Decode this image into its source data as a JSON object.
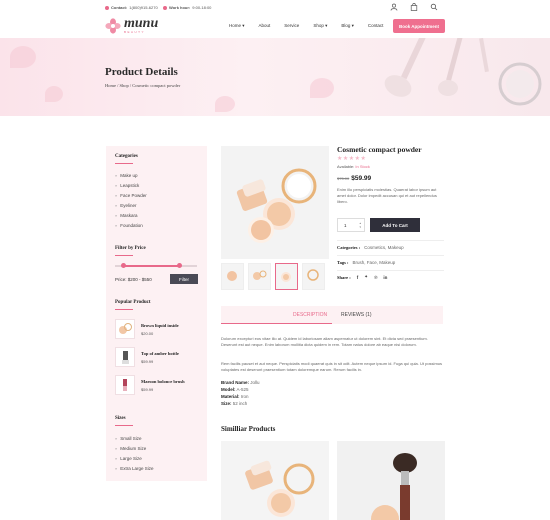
{
  "topbar": {
    "contact_label": "Contact:",
    "contact_value": "1(800)915-6270",
    "hours_label": "Work hour:",
    "hours_value": "9:00-18:00",
    "icons": [
      "user-icon",
      "bag-icon",
      "search-icon"
    ]
  },
  "header": {
    "logo_text": "munu",
    "logo_sub": "BEAUTY",
    "nav": [
      {
        "label": "Home",
        "dropdown": true
      },
      {
        "label": "About",
        "dropdown": false
      },
      {
        "label": "Service",
        "dropdown": false
      },
      {
        "label": "Shop",
        "dropdown": true
      },
      {
        "label": "Blog",
        "dropdown": true
      },
      {
        "label": "Contact",
        "dropdown": false
      }
    ],
    "cta": "Book Appointment"
  },
  "hero": {
    "title": "Product Details",
    "breadcrumb": "Home / Shop / Cosmetic compact powder"
  },
  "sidebar": {
    "categories_title": "Categories",
    "categories": [
      "Make up",
      "Leapstick",
      "Face Powder",
      "Eyeliner",
      "Maskara",
      "Foundation"
    ],
    "filter_title": "Filter by Price",
    "price_label": "Price: $200 - $550",
    "filter_button": "Filter",
    "popular_title": "Popular Product",
    "popular": [
      {
        "name": "Brown liquid inside",
        "price": "$20.00"
      },
      {
        "name": "Top of amber bottle",
        "price": "$59.99"
      },
      {
        "name": "Maroon bolonce brush",
        "price": "$59.99"
      }
    ],
    "sizes_title": "Sizes",
    "sizes": [
      "Small Size",
      "Medium Size",
      "Large Size",
      "Extra Large Size"
    ]
  },
  "product": {
    "title": "Cosmetic compact powder",
    "stars": "★★★★★",
    "available_label": "Available:",
    "available_value": "In Stock",
    "old_price": "$75.00",
    "price": "$59.99",
    "description": "Enim illo perspiciatis molestias. Quaerat labor ipsum aut amet dolor. Dolor impedit accusan qui et aut repellendus libero.",
    "quantity": "1",
    "add_to_cart": "Add To Cart",
    "categories_label": "Categories :",
    "categories_value": "Cosmetics, Makeup",
    "tags_label": "Tags :",
    "tags_value": "Brush, Face, Makeup",
    "share_label": "Share :",
    "share_icons": [
      "facebook-icon",
      "twitter-icon",
      "pinterest-icon",
      "linkedin-icon"
    ]
  },
  "tabs": {
    "description": "DESCRIPTION",
    "reviews": "REVIEWS (1)"
  },
  "content": {
    "para1": "Dolorum excepturi eos vitae illo at. Quidem id laboriosam aliam aspernatur ut dolorem sint. Et dicta sed praesentium. Deserunt est aut neque. Enim laborum mollitia dicta quidem in rem. Totam natus dolore ab eaque nisi dolorum.",
    "para2": "Rem facilis pauset et aut neque. Perspiciatis modi quaerat quis in sit odit. Autem neque ipsum id. Fuga qui quia. Ut possimus voluptates est deserunt praesentium totam doloremque earum. Rerum facilis in.",
    "specs": [
      {
        "label": "Brand Name:",
        "value": "Jollu"
      },
      {
        "label": "Model:",
        "value": "A-525"
      },
      {
        "label": "Material:",
        "value": "Iron"
      },
      {
        "label": "Size:",
        "value": "52 inch"
      }
    ],
    "similar_title": "Similliar Products"
  },
  "colors": {
    "accent": "#ef6f8f",
    "pale": "#fdf1f3",
    "dark": "#2f2f3a"
  }
}
